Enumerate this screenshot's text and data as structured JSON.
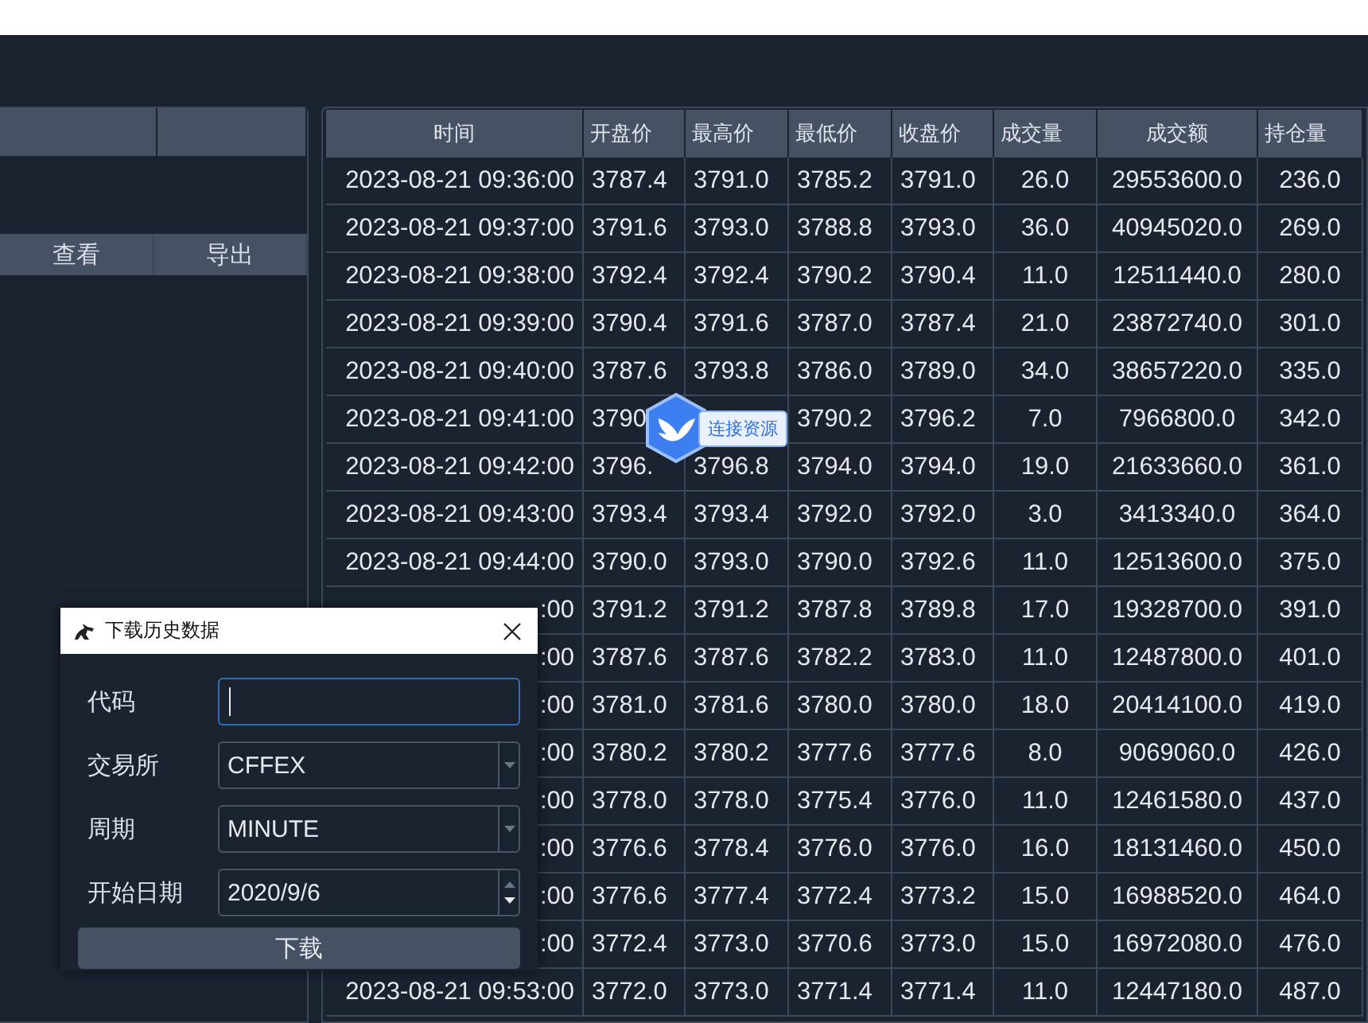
{
  "left_panel": {
    "buttons": [
      "查看",
      "导出"
    ]
  },
  "table": {
    "columns": [
      "时间",
      "开盘价",
      "最高价",
      "最低价",
      "收盘价",
      "成交量",
      "成交额",
      "持仓量"
    ],
    "rows": [
      [
        "2023-08-21 09:36:00",
        "3787.4",
        "3791.0",
        "3785.2",
        "3791.0",
        "26.0",
        "29553600.0",
        "236.0"
      ],
      [
        "2023-08-21 09:37:00",
        "3791.6",
        "3793.0",
        "3788.8",
        "3793.0",
        "36.0",
        "40945020.0",
        "269.0"
      ],
      [
        "2023-08-21 09:38:00",
        "3792.4",
        "3792.4",
        "3790.2",
        "3790.4",
        "11.0",
        "12511440.0",
        "280.0"
      ],
      [
        "2023-08-21 09:39:00",
        "3790.4",
        "3791.6",
        "3787.0",
        "3787.4",
        "21.0",
        "23872740.0",
        "301.0"
      ],
      [
        "2023-08-21 09:40:00",
        "3787.6",
        "3793.8",
        "3786.0",
        "3789.0",
        "34.0",
        "38657220.0",
        "335.0"
      ],
      [
        "2023-08-21 09:41:00",
        "3790",
        null,
        "3790.2",
        "3796.2",
        "7.0",
        "7966800.0",
        "342.0"
      ],
      [
        "2023-08-21 09:42:00",
        "3796.",
        "3796.8",
        "3794.0",
        "3794.0",
        "19.0",
        "21633660.0",
        "361.0"
      ],
      [
        "2023-08-21 09:43:00",
        "3793.4",
        "3793.4",
        "3792.0",
        "3792.0",
        "3.0",
        "3413340.0",
        "364.0"
      ],
      [
        "2023-08-21 09:44:00",
        "3790.0",
        "3793.0",
        "3790.0",
        "3792.6",
        "11.0",
        "12513600.0",
        "375.0"
      ],
      [
        ":00",
        "3791.2",
        "3791.2",
        "3787.8",
        "3789.8",
        "17.0",
        "19328700.0",
        "391.0"
      ],
      [
        ":00",
        "3787.6",
        "3787.6",
        "3782.2",
        "3783.0",
        "11.0",
        "12487800.0",
        "401.0"
      ],
      [
        ":00",
        "3781.0",
        "3781.6",
        "3780.0",
        "3780.0",
        "18.0",
        "20414100.0",
        "419.0"
      ],
      [
        ":00",
        "3780.2",
        "3780.2",
        "3777.6",
        "3777.6",
        "8.0",
        "9069060.0",
        "426.0"
      ],
      [
        ":00",
        "3778.0",
        "3778.0",
        "3775.4",
        "3776.0",
        "11.0",
        "12461580.0",
        "437.0"
      ],
      [
        ":00",
        "3776.6",
        "3778.4",
        "3776.0",
        "3776.0",
        "16.0",
        "18131460.0",
        "450.0"
      ],
      [
        ":00",
        "3776.6",
        "3777.4",
        "3772.4",
        "3773.2",
        "15.0",
        "16988520.0",
        "464.0"
      ],
      [
        ":00",
        "3772.4",
        "3773.0",
        "3770.6",
        "3773.0",
        "15.0",
        "16972080.0",
        "476.0"
      ],
      [
        "2023-08-21 09:53:00",
        "3772.0",
        "3773.0",
        "3771.4",
        "3771.4",
        "11.0",
        "12447180.0",
        "487.0"
      ]
    ]
  },
  "floating_widget": {
    "label": "连接资源"
  },
  "dialog": {
    "title": "下载历史数据",
    "fields": [
      {
        "kind": "text",
        "label": "代码",
        "focused": true
      },
      {
        "kind": "select",
        "label": "交易所",
        "value": "CFFEX",
        "focused": false
      },
      {
        "kind": "select",
        "label": "周期",
        "value": "MINUTE",
        "focused": false
      },
      {
        "kind": "date",
        "label": "开始日期",
        "value": "2020/9/6",
        "focused": false
      }
    ],
    "button": "下载"
  }
}
